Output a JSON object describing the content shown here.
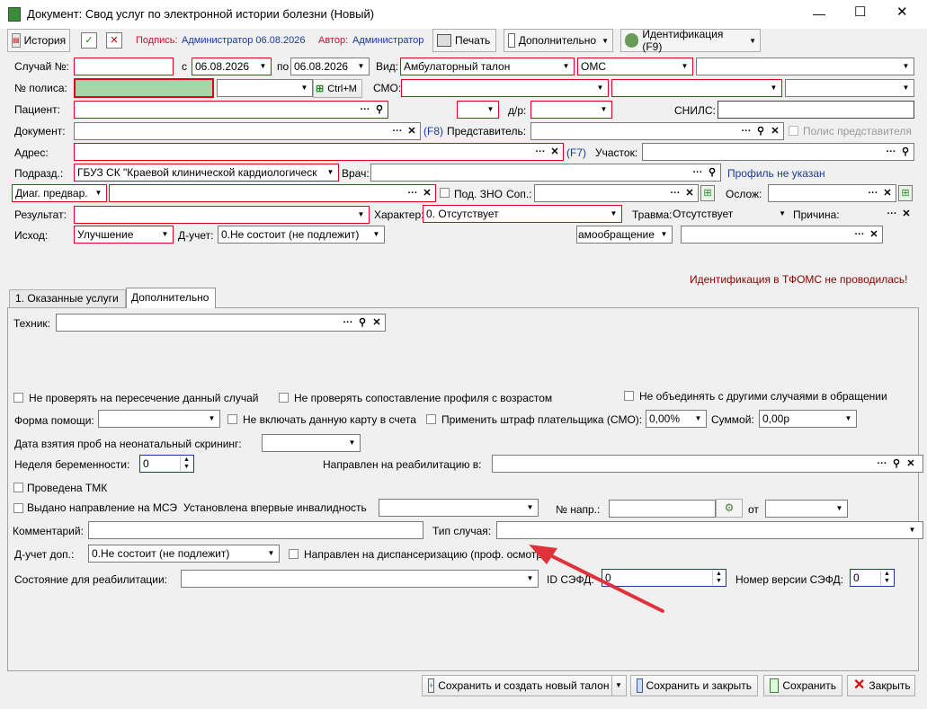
{
  "window": {
    "title": "Документ: Свод услуг по электронной истории болезни (Новый)",
    "controls": [
      "—",
      "☐",
      "✕"
    ]
  },
  "toolbar": {
    "history": "История",
    "signature_label": "Подпись:",
    "signature_value": "Администратор 06.08.2026",
    "author_label": "Автор:",
    "author_value": "Администратор",
    "print": "Печать",
    "more": "Дополнительно",
    "identification": "Идентификация (F9)"
  },
  "form": {
    "case_no_label": "Случай №:",
    "from_label": "с",
    "from_date": "06.08.2026",
    "to_label": "по",
    "to_date": "06.08.2026",
    "kind_label": "Вид:",
    "kind_value": "Амбулаторный талон",
    "pay_value": "ОМС",
    "policy_label": "№ полиса:",
    "policy_hotkey": "Ctrl+M",
    "smo_label": "СМО:",
    "patient_label": "Пациент:",
    "dob_label": "д/р:",
    "snils_label": "СНИЛС:",
    "document_label": "Документ:",
    "f8": "(F8)",
    "representative_label": "Представитель:",
    "rep_policy_label": "Полис представителя",
    "address_label": "Адрес:",
    "f7": "(F7)",
    "district_label": "Участок:",
    "dept_label": "Подразд.:",
    "dept_value": "ГБУЗ СК \"Краевой клинической кардиологическ",
    "doctor_label": "Врач:",
    "profile_note": "Профиль не указан",
    "diag_label": "Диаг. предвар.",
    "sus_zno_label": "Под. ЗНО",
    "sop_label": "Соп.:",
    "oslozh_label": "Ослож:",
    "result_label": "Результат:",
    "character_label": "Характер:",
    "character_value": "0. Отсутствует",
    "trauma_label": "Травма:",
    "trauma_value": "Отсутствует",
    "reason_label": "Причина:",
    "outcome_label": "Исход:",
    "outcome_value": "Улучшение",
    "dreg_label": "Д-учет:",
    "dreg_value": "0.Не состоит (не подлежит)",
    "self_appeal_value": "амообращение",
    "tfoms_note": "Идентификация в ТФОМС не проводилась!"
  },
  "tabs": [
    "1. Оказанные услуги",
    "Дополнительно"
  ],
  "extra": {
    "technician_label": "Техник:",
    "no_cross_check": "Не проверять на пересечение данный случай",
    "no_profile_age": "Не проверять сопоставление профиля с возрастом",
    "no_merge": "Не объединять с другими случаями в обращении",
    "help_form_label": "Форма помощи:",
    "no_include_card": "Не включать данную карту в счета",
    "apply_penalty": "Применить штраф плательщика (СМО):",
    "penalty_pct": "0,00%",
    "sum_label": "Суммой:",
    "sum_value": "0,00р",
    "neonatal_label": "Дата взятия проб на неонатальный скрининг:",
    "pregnancy_label": "Неделя беременности:",
    "pregnancy_value": "0",
    "rehab_sent_label": "Направлен на реабилитацию в:",
    "tmk_label": "Проведена ТМК",
    "mse_label": "Выдано направление на МСЭ",
    "disability_label": "Установлена впервые инвалидность",
    "ref_no_label": "№ напр.:",
    "from_label": "от",
    "comment_label": "Комментарий:",
    "case_type_label": "Тип случая:",
    "dreg_extra_label": "Д-учет доп.:",
    "dreg_extra_value": "0.Не состоит (не подлежит)",
    "dispensary_label": "Направлен на диспансеризацию (проф. осмотр)",
    "rehab_state_label": "Состояние для реабилитации:",
    "sefd_id_label": "ID СЭФД:",
    "sefd_id_value": "0",
    "sefd_ver_label": "Номер версии СЭФД:",
    "sefd_ver_value": "0"
  },
  "bottom": {
    "save_new": "Сохранить и создать новый талон",
    "save_close": "Сохранить и закрыть",
    "save": "Сохранить",
    "close": "Закрыть"
  }
}
